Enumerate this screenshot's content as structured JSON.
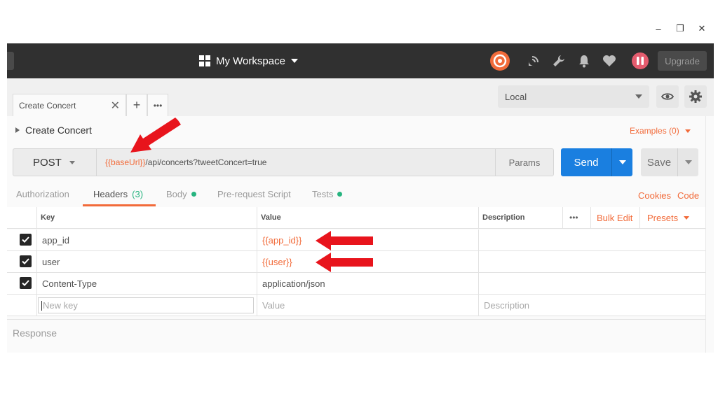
{
  "window": {
    "minimize": "–",
    "maximize": "❐",
    "close": "✕"
  },
  "header": {
    "workspace_label": "My Workspace",
    "upgrade_label": "Upgrade"
  },
  "tabs": {
    "active_tab_label": "Create Concert",
    "new_tab": "+",
    "more": "•••"
  },
  "environment": {
    "selected": "Local"
  },
  "request": {
    "name": "Create Concert",
    "examples_label": "Examples (0)",
    "method": "POST",
    "url_var": "{{baseUrl}}",
    "url_rest": "/api/concerts?tweetConcert=true",
    "params_label": "Params",
    "send_label": "Send",
    "save_label": "Save"
  },
  "subtabs": {
    "authorization": "Authorization",
    "headers": "Headers",
    "headers_count": "(3)",
    "body": "Body",
    "prerequest": "Pre-request Script",
    "tests": "Tests",
    "cookies": "Cookies",
    "code": "Code"
  },
  "table": {
    "col_key": "Key",
    "col_value": "Value",
    "col_description": "Description",
    "more": "•••",
    "bulk_edit": "Bulk Edit",
    "presets": "Presets",
    "rows": [
      {
        "key": "app_id",
        "value": "{{app_id}}",
        "checked": true
      },
      {
        "key": "user",
        "value": "{{user}}",
        "checked": true
      },
      {
        "key": "Content-Type",
        "value": "application/json",
        "checked": true
      }
    ],
    "new_key_placeholder": "New key",
    "value_placeholder": "Value",
    "description_placeholder": "Description"
  },
  "response_label": "Response",
  "colors": {
    "accent": "#f26b3a",
    "send": "#1a7fe0",
    "header_bg": "#303030",
    "annotation": "#e8141c",
    "dot": "#26b47f"
  }
}
